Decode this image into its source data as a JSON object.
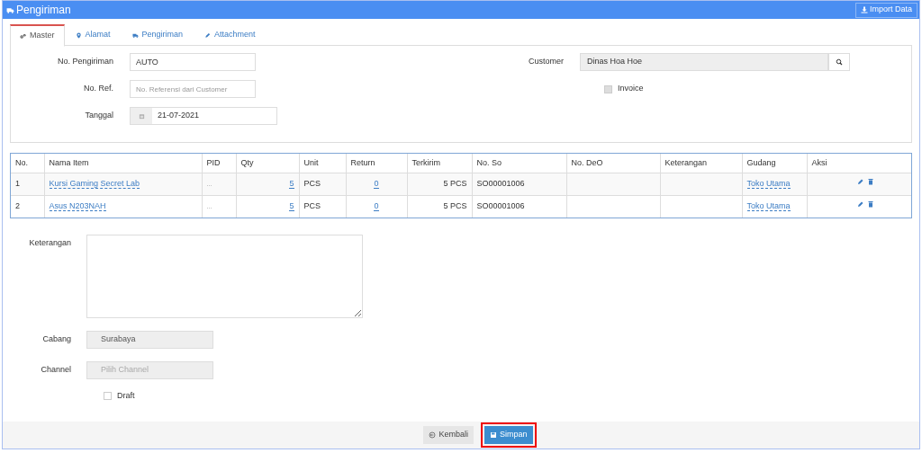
{
  "header": {
    "title": "Pengiriman",
    "import_button": "Import Data"
  },
  "tabs": [
    {
      "label": "Master",
      "kind": "gears",
      "selected": true
    },
    {
      "label": "Alamat",
      "kind": "pin",
      "selected": false
    },
    {
      "label": "Pengiriman",
      "kind": "truck",
      "selected": false
    },
    {
      "label": "Attachment",
      "kind": "clip",
      "selected": false
    }
  ],
  "form": {
    "no_pengiriman": {
      "label": "No. Pengiriman",
      "value": "AUTO"
    },
    "no_ref": {
      "label": "No. Ref.",
      "placeholder": "No. Referensi dari Customer"
    },
    "tanggal": {
      "label": "Tanggal",
      "value": "21-07-2021"
    },
    "customer": {
      "label": "Customer",
      "value": "Dinas Hoa Hoe"
    },
    "invoice": {
      "label": "Invoice",
      "checked": false
    }
  },
  "table": {
    "columns": [
      "No.",
      "Nama Item",
      "PID",
      "Qty",
      "Unit",
      "Return",
      "Terkirim",
      "No. So",
      "No. DeO",
      "Keterangan",
      "Gudang",
      "Aksi"
    ],
    "rows": [
      {
        "no": "1",
        "item": "Kursi Gaming Secret Lab",
        "pid": "...",
        "qty": "5",
        "unit": "PCS",
        "return": "0",
        "terkirim": "5 PCS",
        "so": "SO00001006",
        "gudang": "Toko Utama"
      },
      {
        "no": "2",
        "item": "Asus N203NAH",
        "pid": "...",
        "qty": "5",
        "unit": "PCS",
        "return": "0",
        "terkirim": "5 PCS",
        "so": "SO00001006",
        "gudang": "Toko Utama"
      }
    ]
  },
  "lower": {
    "keterangan": {
      "label": "Keterangan"
    },
    "cabang": {
      "label": "Cabang",
      "value": "Surabaya"
    },
    "channel": {
      "label": "Channel",
      "placeholder": "Pilih Channel"
    },
    "draft": {
      "label": "Draft",
      "checked": false
    }
  },
  "footer": {
    "buttons": [
      {
        "label": "Kembali",
        "kind": "back",
        "highlighted": false
      },
      {
        "label": "Simpan",
        "kind": "save",
        "highlighted": true
      }
    ]
  }
}
